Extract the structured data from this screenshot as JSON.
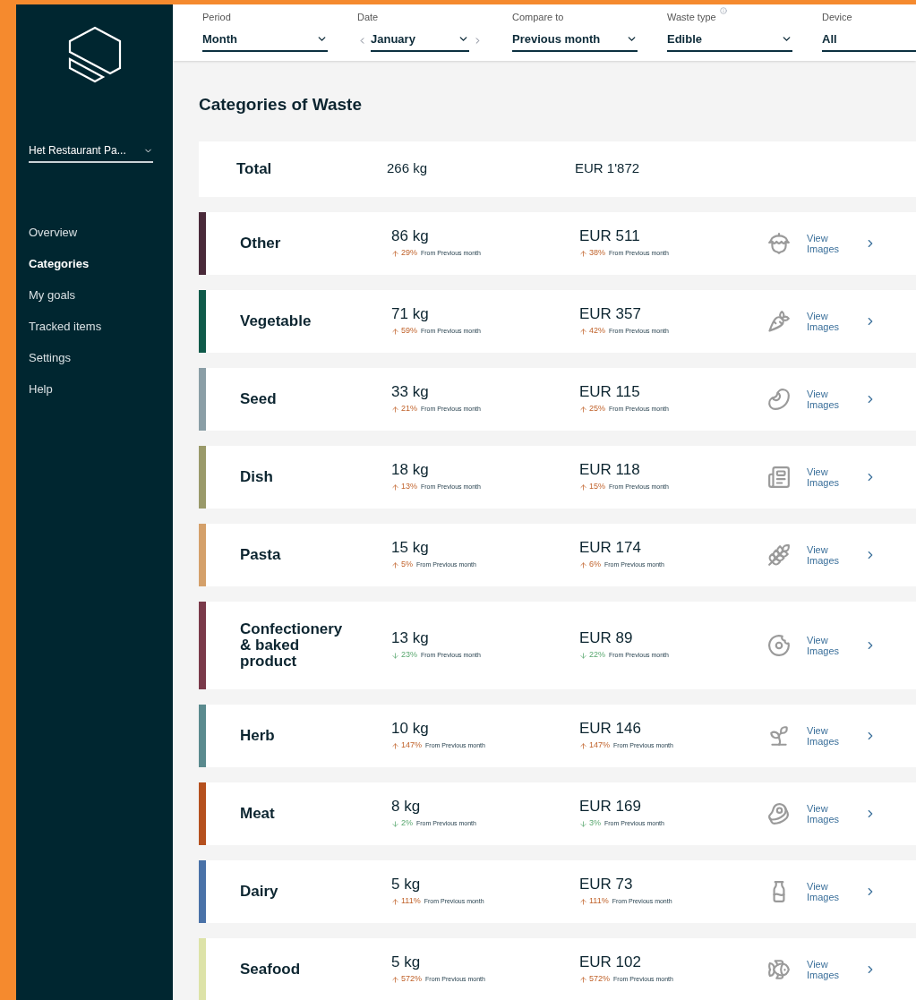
{
  "sidebar": {
    "restaurant": "Het Restaurant Pa...",
    "nav": [
      {
        "label": "Overview",
        "selected": false
      },
      {
        "label": "Categories",
        "selected": true
      },
      {
        "label": "My goals",
        "selected": false
      },
      {
        "label": "Tracked items",
        "selected": false
      },
      {
        "label": "Settings",
        "selected": false
      },
      {
        "label": "Help",
        "selected": false
      }
    ]
  },
  "filters": [
    {
      "label": "Period",
      "value": "Month",
      "kind": "dropdown"
    },
    {
      "label": "Date",
      "value": "January",
      "kind": "stepper"
    },
    {
      "label": "Compare to",
      "value": "Previous month",
      "kind": "dropdown"
    },
    {
      "label": "Waste type",
      "value": "Edible",
      "kind": "info-dropdown"
    },
    {
      "label": "Device",
      "value": "All",
      "kind": "plain"
    }
  ],
  "title": "Categories of Waste",
  "total": {
    "label": "Total",
    "weight": "266 kg",
    "cost": "EUR 1'872"
  },
  "categories": [
    {
      "name": "Other",
      "color": "#4a2a3a",
      "weight": "86 kg",
      "weight_change": {
        "increase": true,
        "value": "29%",
        "text": "From Previous month"
      },
      "cost": "EUR 511",
      "cost_change": {
        "increase": true,
        "value": "38%",
        "text": "From Previous month"
      },
      "link": "View Images"
    },
    {
      "name": "Vegetable",
      "color": "#0f5a4a",
      "weight": "71 kg",
      "weight_change": {
        "increase": true,
        "value": "59%",
        "text": "From Previous month"
      },
      "cost": "EUR 357",
      "cost_change": {
        "increase": true,
        "value": "42%",
        "text": "From Previous month"
      },
      "link": "View Images"
    },
    {
      "name": "Seed",
      "color": "#8a9ea6",
      "weight": "33 kg",
      "weight_change": {
        "increase": true,
        "value": "21%",
        "text": "From Previous month"
      },
      "cost": "EUR 115",
      "cost_change": {
        "increase": true,
        "value": "25%",
        "text": "From Previous month"
      },
      "link": "View Images"
    },
    {
      "name": "Dish",
      "color": "#9a9a6a",
      "weight": "18 kg",
      "weight_change": {
        "increase": true,
        "value": "13%",
        "text": "From Previous month"
      },
      "cost": "EUR 118",
      "cost_change": {
        "increase": true,
        "value": "15%",
        "text": "From Previous month"
      },
      "link": "View Images"
    },
    {
      "name": "Pasta",
      "color": "#d4a06a",
      "weight": "15 kg",
      "weight_change": {
        "increase": true,
        "value": "5%",
        "text": "From Previous month"
      },
      "cost": "EUR 174",
      "cost_change": {
        "increase": true,
        "value": "6%",
        "text": "From Previous month"
      },
      "link": "View Images"
    },
    {
      "name": "Confectionery & baked product",
      "color": "#7a3a4a",
      "weight": "13 kg",
      "weight_change": {
        "increase": false,
        "value": "23%",
        "text": "From Previous month"
      },
      "cost": "EUR 89",
      "cost_change": {
        "increase": false,
        "value": "22%",
        "text": "From Previous month"
      },
      "link": "View Images"
    },
    {
      "name": "Herb",
      "color": "#5a8a8e",
      "weight": "10 kg",
      "weight_change": {
        "increase": true,
        "value": "147%",
        "text": "From Previous month"
      },
      "cost": "EUR 146",
      "cost_change": {
        "increase": true,
        "value": "147%",
        "text": "From Previous month"
      },
      "link": "View Images"
    },
    {
      "name": "Meat",
      "color": "#b5501e",
      "weight": "8 kg",
      "weight_change": {
        "increase": false,
        "value": "2%",
        "text": "From Previous month"
      },
      "cost": "EUR 169",
      "cost_change": {
        "increase": false,
        "value": "3%",
        "text": "From Previous month"
      },
      "link": "View Images"
    },
    {
      "name": "Dairy",
      "color": "#4a72a8",
      "weight": "5 kg",
      "weight_change": {
        "increase": true,
        "value": "111%",
        "text": "From Previous month"
      },
      "cost": "EUR 73",
      "cost_change": {
        "increase": true,
        "value": "111%",
        "text": "From Previous month"
      },
      "link": "View Images"
    },
    {
      "name": "Seafood",
      "color": "#dde3a8",
      "weight": "5 kg",
      "weight_change": {
        "increase": true,
        "value": "572%",
        "text": "From Previous month"
      },
      "cost": "EUR 102",
      "cost_change": {
        "increase": true,
        "value": "572%",
        "text": "From Previous month"
      },
      "link": "View Images"
    }
  ]
}
